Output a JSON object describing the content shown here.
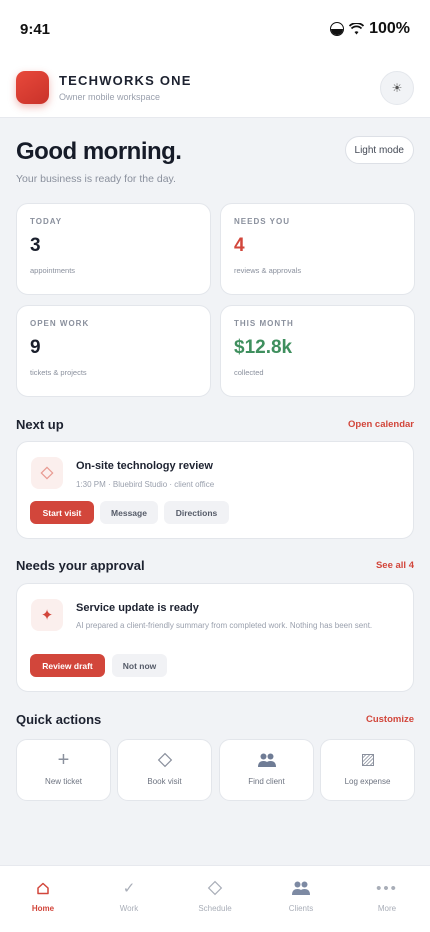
{
  "status_bar": {
    "time": "9:41",
    "battery": "100%"
  },
  "app": {
    "name": "TECHWORKS ONE",
    "subtitle": "Owner mobile workspace",
    "theme_icon": "sun-icon"
  },
  "greeting": {
    "title": "Good morning.",
    "subtitle": "Your business is ready for the day.",
    "mode_label": "Light mode"
  },
  "stats": [
    {
      "label": "TODAY",
      "value": "3",
      "note": "appointments",
      "color": "#1a1f2c"
    },
    {
      "label": "NEEDS YOU",
      "value": "4",
      "note": "reviews & approvals",
      "color": "#d2463b"
    },
    {
      "label": "OPEN WORK",
      "value": "9",
      "note": "tickets & projects",
      "color": "#1a1f2c"
    },
    {
      "label": "THIS MONTH",
      "value": "$12.8k",
      "note": "collected",
      "color": "#3f8f5e"
    }
  ],
  "next_up": {
    "title": "Next up",
    "link": "Open calendar",
    "card": {
      "icon": "diamond-icon",
      "title": "On-site technology review",
      "meta": "1:30 PM · Bluebird Studio · client office",
      "buttons": [
        "Start visit",
        "Message",
        "Directions"
      ]
    }
  },
  "approval": {
    "title": "Needs your approval",
    "link": "See all 4",
    "card": {
      "icon": "sparkle-icon",
      "title": "Service update is ready",
      "meta": "AI prepared a client-friendly summary from completed work. Nothing has been sent.",
      "buttons": [
        "Review draft",
        "Not now"
      ]
    }
  },
  "quick_actions": {
    "title": "Quick actions",
    "link": "Customize",
    "items": [
      {
        "label": "New ticket",
        "icon": "plus-icon"
      },
      {
        "label": "Book visit",
        "icon": "diamond-icon"
      },
      {
        "label": "Find client",
        "icon": "people-icon"
      },
      {
        "label": "Log expense",
        "icon": "receipt-icon"
      }
    ]
  },
  "tabs": [
    {
      "label": "Home",
      "icon": "home-icon",
      "active": true
    },
    {
      "label": "Work",
      "icon": "check-icon"
    },
    {
      "label": "Schedule",
      "icon": "diamond-icon"
    },
    {
      "label": "Clients",
      "icon": "people-icon"
    },
    {
      "label": "More",
      "icon": "more-icon"
    }
  ],
  "colors": {
    "accent": "#d2463b",
    "positive": "#3f8f5e",
    "background": "#f1f3f6"
  }
}
